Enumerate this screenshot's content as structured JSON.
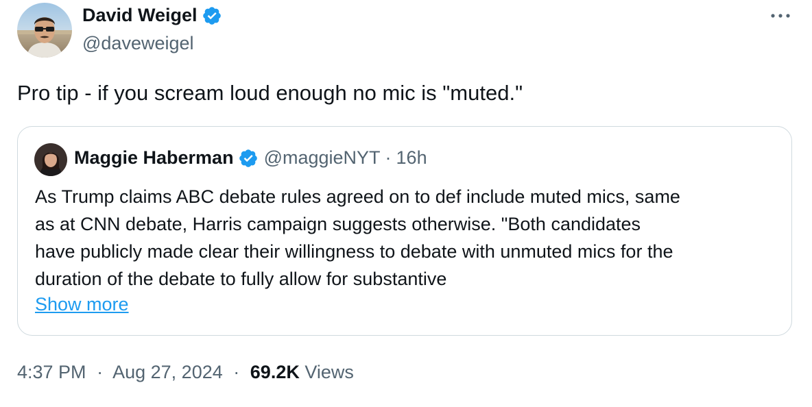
{
  "author": {
    "name": "David Weigel",
    "handle": "@daveweigel",
    "verified": true
  },
  "tweet": {
    "text": "Pro tip - if you scream loud enough no mic is \"muted.\""
  },
  "quoted_tweet": {
    "author_name": "Maggie Haberman",
    "handle": "@maggieNYT",
    "separator": "·",
    "time": "16h",
    "text_lines": [
      "As Trump claims ABC debate rules agreed on to def include muted mics, same",
      "as at CNN debate, Harris campaign suggests otherwise. \"Both candidates",
      "have publicly made clear their willingness to debate with unmuted mics for the",
      "duration of the debate to fully allow for substantive"
    ],
    "show_more_label": "Show more"
  },
  "meta": {
    "time": "4:37 PM",
    "separator": "·",
    "date": "Aug 27, 2024",
    "views_count": "69.2K",
    "views_label": "Views"
  },
  "icons": {
    "verified": "verified-badge-icon",
    "more": "more-horizontal-icon"
  },
  "colors": {
    "verified": "#1d9bf0",
    "link": "#1d9bf0",
    "secondary_text": "#536471",
    "border": "#cfd9de"
  }
}
